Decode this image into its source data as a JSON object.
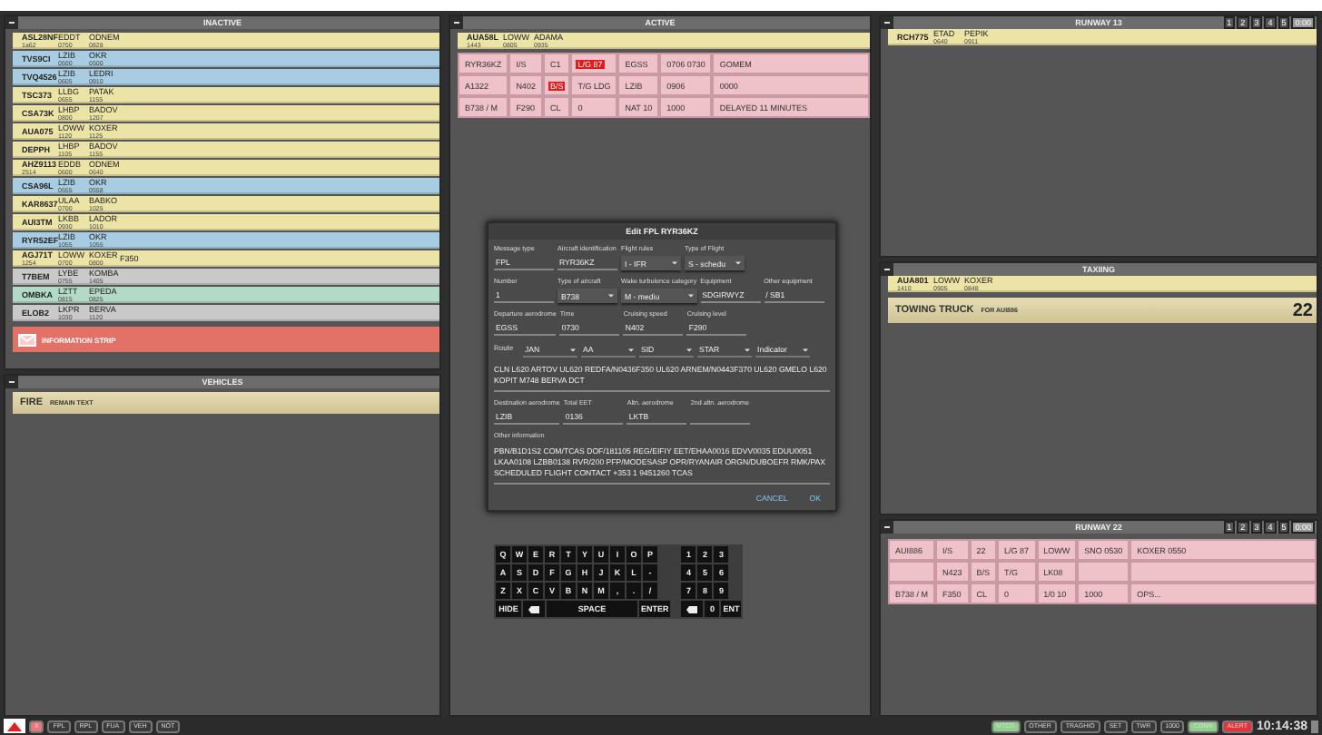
{
  "inactive": {
    "title": "INACTIVE",
    "strips": [
      {
        "callsign": "ASL28NF",
        "sub": "1a62",
        "points": [
          [
            "EDDT",
            "0700"
          ],
          [
            "ODNEM",
            "0828"
          ]
        ],
        "color": "#ece3a6"
      },
      {
        "callsign": "TVS9CI",
        "points": [
          [
            "LZIB",
            "0500"
          ],
          [
            "OKR",
            "0500"
          ]
        ],
        "color": "#a8cde2"
      },
      {
        "callsign": "TVQ4526",
        "points": [
          [
            "LZIB",
            "0605"
          ],
          [
            "LEDRI",
            "0910"
          ]
        ],
        "color": "#a8cde2"
      },
      {
        "callsign": "TSC373",
        "points": [
          [
            "LLBG",
            "0655"
          ],
          [
            "PATAK",
            "1155"
          ]
        ],
        "color": "#ece3a6"
      },
      {
        "callsign": "CSA73K",
        "points": [
          [
            "LHBP",
            "0800"
          ],
          [
            "BADOV",
            "1207"
          ]
        ],
        "color": "#ece3a6"
      },
      {
        "callsign": "AUA075",
        "points": [
          [
            "LOWW",
            "1120"
          ],
          [
            "KOXER",
            "1125"
          ]
        ],
        "color": "#ece3a6"
      },
      {
        "callsign": "DEPPH",
        "points": [
          [
            "LHBP",
            "1105"
          ],
          [
            "BADOV",
            "1155"
          ]
        ],
        "color": "#ece3a6"
      },
      {
        "callsign": "AHZ9113",
        "sub": "2514",
        "points": [
          [
            "EDDB",
            "0600"
          ],
          [
            "ODNEM",
            "0640"
          ]
        ],
        "color": "#ece3a6"
      },
      {
        "callsign": "CSA96L",
        "points": [
          [
            "LZIB",
            "0555"
          ],
          [
            "OKR",
            "0558"
          ]
        ],
        "color": "#a8cde2"
      },
      {
        "callsign": "KAR8637",
        "points": [
          [
            "ULAA",
            "0700"
          ],
          [
            "BABKO",
            "1025"
          ]
        ],
        "color": "#ece3a6"
      },
      {
        "callsign": "AUI3TM",
        "points": [
          [
            "LKBB",
            "0930"
          ],
          [
            "LADOR",
            "1010"
          ]
        ],
        "color": "#ece3a6"
      },
      {
        "callsign": "RYR52EF",
        "points": [
          [
            "LZIB",
            "1055"
          ],
          [
            "OKR",
            "1055"
          ]
        ],
        "color": "#a8cde2"
      },
      {
        "callsign": "AGJ71T",
        "sub": "1254",
        "points": [
          [
            "LOWW",
            "0700"
          ],
          [
            "KOXER",
            "0800"
          ]
        ],
        "extra": "F350",
        "color": "#ece3a6"
      },
      {
        "callsign": "T7BEM",
        "points": [
          [
            "LYBE",
            "0755"
          ],
          [
            "KOMBA",
            "1405"
          ]
        ],
        "color": "#c9c9c9"
      },
      {
        "callsign": "OMBKA",
        "points": [
          [
            "LZTT",
            "0815"
          ],
          [
            "EPEDA",
            "0825"
          ]
        ],
        "color": "#b3dac6"
      },
      {
        "callsign": "ELOB2",
        "points": [
          [
            "LKPR",
            "1030"
          ],
          [
            "BERVA",
            "1120"
          ]
        ],
        "color": "#c9c9c9"
      }
    ],
    "info": "INFORMATION STRIP"
  },
  "vehicles": {
    "title": "VEHICLES",
    "strips": [
      {
        "name": "FIRE",
        "text": "REMAIN TEXT"
      }
    ]
  },
  "active": {
    "title": "ACTIVE",
    "strip": {
      "callsign": "AUA58L",
      "sub": "1443",
      "points": [
        [
          "LOWW",
          "0805"
        ],
        [
          "ADAMA",
          "0935"
        ]
      ]
    },
    "flight": [
      [
        {
          "text": "RYR36KZ",
          "highlight": false
        },
        {
          "text": "I/S",
          "highlight": false
        },
        {
          "text": "C1",
          "highlight": false
        },
        {
          "text": "L/G 87",
          "highlight": true
        },
        {
          "text": "EGSS",
          "highlight": false
        },
        {
          "text": "0706 0730",
          "highlight": false
        },
        {
          "text": "GOMEM",
          "highlight": false
        }
      ],
      [
        {
          "text": "A1322",
          "highlight": false
        },
        {
          "text": "N402",
          "highlight": false
        },
        {
          "text": "B/S",
          "highlight": true
        },
        {
          "text": "T/G LDG",
          "highlight": false
        },
        {
          "text": "LZIB",
          "highlight": false
        },
        {
          "text": "0906",
          "highlight": false
        },
        {
          "text": "0000",
          "highlight": false
        }
      ],
      [
        {
          "text": "B738 / M",
          "highlight": false
        },
        {
          "text": "F290",
          "highlight": false
        },
        {
          "text": "CL",
          "highlight": false
        },
        {
          "text": "0",
          "highlight": false
        },
        {
          "text": "NAT 10",
          "highlight": false
        },
        {
          "text": "1000",
          "highlight": false
        },
        {
          "text": "DELAYED 11 MINUTES",
          "highlight": false
        }
      ]
    ]
  },
  "dialog": {
    "title": "Edit FPL RYR36KZ",
    "rows": [
      [
        {
          "kind": "text",
          "label": "Message type",
          "value": "FPL"
        },
        {
          "kind": "text",
          "label": "Aircraft identification",
          "value": "RYR36KZ"
        },
        {
          "kind": "select",
          "label": "Flight rules",
          "value": "I - IFR"
        },
        {
          "kind": "select",
          "label": "Type of Flight",
          "value": "S - schedu"
        }
      ],
      [
        {
          "kind": "text",
          "label": "Number",
          "value": "1"
        },
        {
          "kind": "select",
          "label": "Type of aircraft",
          "value": "B738"
        },
        {
          "kind": "select",
          "label": "Wake turbulence category",
          "value": "M - mediu"
        },
        {
          "kind": "text",
          "label": "Equipment",
          "value": "SDGIRWYZ"
        },
        {
          "kind": "text",
          "label": "Other equipment",
          "value": "/ SB1"
        }
      ],
      [
        {
          "kind": "text",
          "label": "Departure aerodrome",
          "value": "EGSS"
        },
        {
          "kind": "text",
          "label": "Time",
          "value": "0730"
        },
        {
          "kind": "text",
          "label": "Cruising speed",
          "value": "N402"
        },
        {
          "kind": "text",
          "label": "Cruising level",
          "value": "F290"
        }
      ]
    ],
    "route_label": "Route",
    "route_selects": [
      "JAN",
      "AA",
      "SID",
      "STAR",
      "Indicator"
    ],
    "route": "CLN L620 ARTOV UL620 REDFA/N0436F350 UL620 ARNEM/N0443F370 UL620 GMELO L620 KOPIT M748 BERVA DCT",
    "dest_row": [
      {
        "kind": "text",
        "label": "Destination aerodrome",
        "value": "LZIB"
      },
      {
        "kind": "text",
        "label": "Total EET",
        "value": "0136"
      },
      {
        "kind": "text",
        "label": "Altn. aerodrome",
        "value": "LKTB"
      },
      {
        "kind": "text",
        "label": "2nd altn. aerodrome"
      }
    ],
    "other_label": "Other information",
    "other": "PBN/B1D1S2 COM/TCAS DOF/181105 REG/EIFIY EET/EHAA0016 EDVV0035 EDUU0051 LKAA0108 LZBB0138 RVR/200 PFP/MODESASP OPR/RYANAIR ORGN/DUBOEFR RMK/PAX SCHEDULED FLIGHT CONTACT +353 1 9451260 TCAS",
    "buttons": [
      "CANCEL",
      "OK"
    ]
  },
  "keyboard": {
    "letters": [
      [
        "Q",
        "W",
        "E",
        "R",
        "T",
        "Y",
        "U",
        "I",
        "O",
        "P"
      ],
      [
        "A",
        "S",
        "D",
        "F",
        "G",
        "H",
        "J",
        "K",
        "L",
        "-"
      ],
      [
        "Z",
        "X",
        "C",
        "V",
        "B",
        "N",
        "M",
        ",",
        ".",
        "/"
      ]
    ],
    "bottom": [
      {
        "kind": "text",
        "text": "HIDE"
      },
      {
        "kind": "backspace"
      },
      {
        "kind": "wide",
        "text": "SPACE"
      },
      {
        "kind": "text",
        "text": "ENTER"
      }
    ],
    "numbers": [
      [
        "1",
        "2",
        "3"
      ],
      [
        "4",
        "5",
        "6"
      ],
      [
        "7",
        "8",
        "9"
      ]
    ],
    "num_bottom": [
      {
        "kind": "backspace"
      },
      {
        "kind": "key",
        "text": "0"
      },
      {
        "kind": "key",
        "text": "ENT"
      }
    ]
  },
  "runway13": {
    "title": "RUNWAY 13",
    "buttons": [
      {
        "label": "1",
        "selected": false
      },
      {
        "label": "2",
        "selected": false
      },
      {
        "label": "3",
        "selected": false
      },
      {
        "label": "4",
        "selected": false
      },
      {
        "label": "5",
        "selected": false
      },
      {
        "label": "0:00",
        "selected": true
      }
    ],
    "strips": [
      {
        "callsign": "RCH775",
        "points": [
          [
            "ETAD",
            "0640"
          ],
          [
            "PEPIK",
            "0911"
          ]
        ]
      }
    ]
  },
  "taxiing": {
    "title": "TAXIING",
    "strip": {
      "callsign": "AUA801",
      "sub": "1410",
      "points": [
        [
          "LOWW",
          "0905"
        ],
        [
          "KOXER",
          "0848"
        ]
      ]
    },
    "vehicle": {
      "name": "TOWING TRUCK",
      "text": "FOR AUI886",
      "runway": "22"
    }
  },
  "runway22": {
    "title": "RUNWAY 22",
    "buttons": [
      {
        "label": "1",
        "selected": false
      },
      {
        "label": "2",
        "selected": false
      },
      {
        "label": "3",
        "selected": false
      },
      {
        "label": "4",
        "selected": false
      },
      {
        "label": "5",
        "selected": false
      },
      {
        "label": "0:00",
        "selected": true
      }
    ],
    "flight": [
      [
        {
          "text": "AUI886",
          "highlight": false
        },
        {
          "text": "I/S",
          "highlight": false
        },
        {
          "text": "22",
          "highlight": false
        },
        {
          "text": "L/G 87",
          "highlight": false
        },
        {
          "text": "LOWW",
          "highlight": false
        },
        {
          "text": "SNO 0530",
          "highlight": false
        },
        {
          "text": "KOXER 0550",
          "highlight": false
        }
      ],
      [
        {
          "highlight": false
        },
        {
          "text": "N423",
          "highlight": false
        },
        {
          "text": "B/S",
          "highlight": false
        },
        {
          "text": "T/G",
          "highlight": false
        },
        {
          "text": "LK08",
          "highlight": false
        },
        {
          "highlight": false
        },
        {
          "highlight": false
        }
      ],
      [
        {
          "text": "B738 / M",
          "highlight": false
        },
        {
          "text": "F350",
          "highlight": false
        },
        {
          "text": "CL",
          "highlight": false
        },
        {
          "text": "0",
          "highlight": false
        },
        {
          "text": "1/0 10",
          "highlight": false
        },
        {
          "text": "1000",
          "highlight": false
        },
        {
          "text": "OPS...",
          "highlight": false
        }
      ]
    ]
  },
  "taskbar": {
    "left": [
      {
        "label": "X",
        "color": "#e8777a"
      },
      {
        "label": "FPL",
        "color": "#3a3a3a"
      },
      {
        "label": "RPL",
        "color": "#3a3a3a"
      },
      {
        "label": "FUA",
        "color": "#3a3a3a"
      },
      {
        "label": "VEH",
        "color": "#3a3a3a"
      },
      {
        "label": "NOT",
        "color": "#3a3a3a"
      }
    ],
    "right": [
      {
        "label": "MTCD",
        "color": "#8fd08a"
      },
      {
        "label": "OTHER",
        "color": "#3a3a3a"
      },
      {
        "label": "TRAGHIO",
        "color": "#3a3a3a"
      },
      {
        "label": "SET",
        "color": "#3a3a3a"
      },
      {
        "label": "TWR",
        "color": "#3a3a3a"
      },
      {
        "label": "1000",
        "color": "#3a3a3a"
      },
      {
        "label": "CONN",
        "color": "#8fd08a"
      },
      {
        "label": "ALERT",
        "color": "#e8323a"
      }
    ],
    "clock": "10:14:38"
  }
}
